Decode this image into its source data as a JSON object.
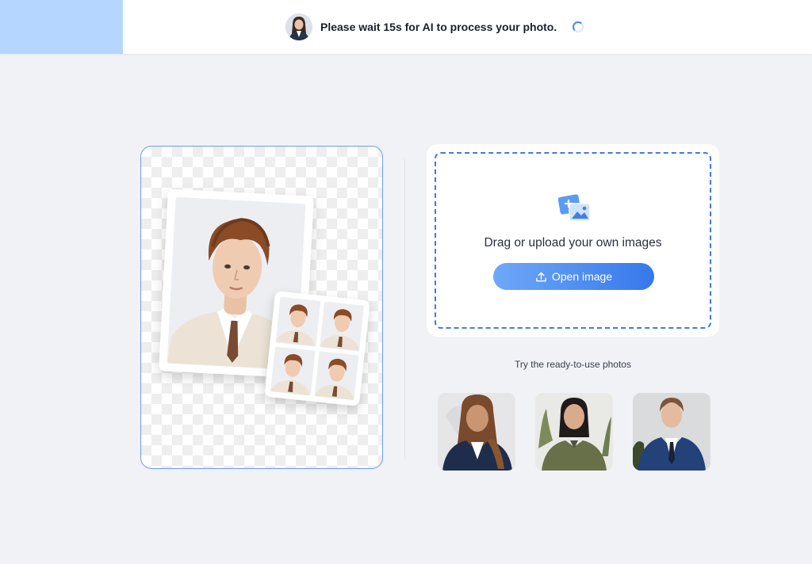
{
  "header": {
    "status_message": "Please wait 15s for AI to process your photo.",
    "avatar_icon": "user-avatar-icon",
    "spinner_icon": "loading-spinner-icon",
    "accent_color": "#b4d6ff"
  },
  "preview": {
    "main_photo_icon": "portrait-photo",
    "sheet_icon": "passport-photo-sheet",
    "border_color": "#6e9cf0"
  },
  "upload": {
    "illustration_icon": "add-image-icon",
    "drag_text": "Drag or upload your own images",
    "open_button_label": "Open image",
    "open_button_icon": "upload-icon",
    "dropzone_color": "#4279e8"
  },
  "samples": {
    "label": "Try the ready-to-use photos",
    "items": [
      {
        "icon": "sample-woman-suit-photo"
      },
      {
        "icon": "sample-woman-green-shirt-photo"
      },
      {
        "icon": "sample-man-suit-photo"
      }
    ]
  }
}
